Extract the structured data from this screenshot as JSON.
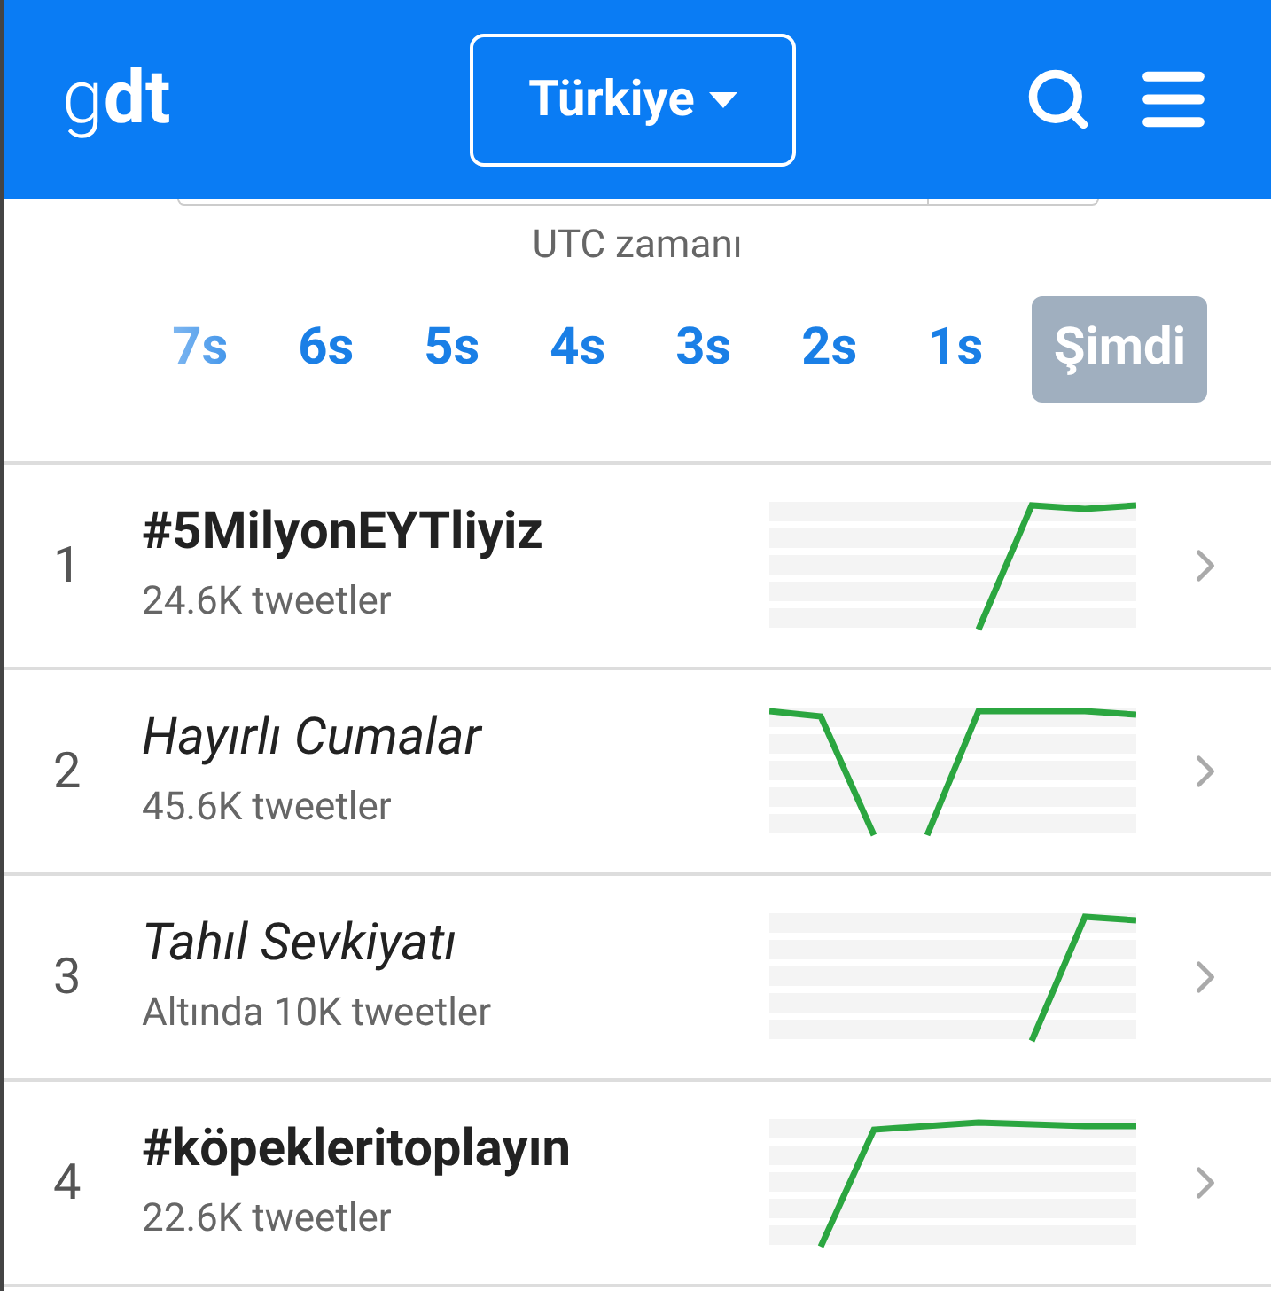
{
  "header": {
    "logo": "g**dt**",
    "country": "Türkiye"
  },
  "time": {
    "caption": "UTC zamanı",
    "tabs": [
      {
        "label": "7s",
        "selected": false
      },
      {
        "label": "6s",
        "selected": false
      },
      {
        "label": "5s",
        "selected": false
      },
      {
        "label": "4s",
        "selected": false
      },
      {
        "label": "3s",
        "selected": false
      },
      {
        "label": "2s",
        "selected": false
      },
      {
        "label": "1s",
        "selected": false
      },
      {
        "label": "Şimdi",
        "selected": true
      }
    ]
  },
  "trends": [
    {
      "rank": "1",
      "title": "#5MilyonEYTliyiz",
      "kind": "hashtag",
      "count": "24.6K tweetler"
    },
    {
      "rank": "2",
      "title": "Hayırlı Cumalar",
      "kind": "phrase",
      "count": "45.6K tweetler"
    },
    {
      "rank": "3",
      "title": "Tahıl Sevkiyatı",
      "kind": "phrase",
      "count": "Altında 10K tweetler"
    },
    {
      "rank": "4",
      "title": "#köpekleritoplayın",
      "kind": "hashtag",
      "count": "22.6K tweetler"
    }
  ]
}
